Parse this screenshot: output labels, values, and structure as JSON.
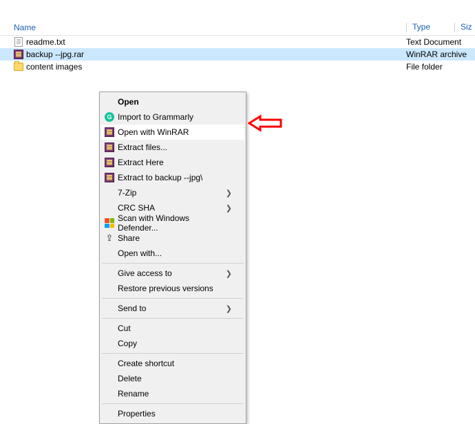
{
  "columns": {
    "name": "Name",
    "type": "Type",
    "size": "Siz"
  },
  "files": [
    {
      "name": "readme.txt",
      "type": "Text Document",
      "icon": "txt",
      "selected": false
    },
    {
      "name": "backup --jpg.rar",
      "type": "WinRAR archive",
      "icon": "rar",
      "selected": true
    },
    {
      "name": "content images",
      "type": "File folder",
      "icon": "folder",
      "selected": false
    }
  ],
  "context_menu": [
    {
      "kind": "item",
      "label": "Open",
      "bold": true,
      "icon": ""
    },
    {
      "kind": "item",
      "label": "Import to Grammarly",
      "icon": "grammarly"
    },
    {
      "kind": "item",
      "label": "Open with WinRAR",
      "icon": "rar",
      "highlighted": true
    },
    {
      "kind": "item",
      "label": "Extract files...",
      "icon": "rar"
    },
    {
      "kind": "item",
      "label": "Extract Here",
      "icon": "rar"
    },
    {
      "kind": "item",
      "label": "Extract to backup --jpg\\",
      "icon": "rar"
    },
    {
      "kind": "item",
      "label": "7-Zip",
      "submenu": true
    },
    {
      "kind": "item",
      "label": "CRC SHA",
      "submenu": true
    },
    {
      "kind": "item",
      "label": "Scan with Windows Defender...",
      "icon": "defender"
    },
    {
      "kind": "item",
      "label": "Share",
      "icon": "share"
    },
    {
      "kind": "item",
      "label": "Open with..."
    },
    {
      "kind": "sep"
    },
    {
      "kind": "item",
      "label": "Give access to",
      "submenu": true
    },
    {
      "kind": "item",
      "label": "Restore previous versions"
    },
    {
      "kind": "sep"
    },
    {
      "kind": "item",
      "label": "Send to",
      "submenu": true
    },
    {
      "kind": "sep"
    },
    {
      "kind": "item",
      "label": "Cut"
    },
    {
      "kind": "item",
      "label": "Copy"
    },
    {
      "kind": "sep"
    },
    {
      "kind": "item",
      "label": "Create shortcut"
    },
    {
      "kind": "item",
      "label": "Delete"
    },
    {
      "kind": "item",
      "label": "Rename"
    },
    {
      "kind": "sep"
    },
    {
      "kind": "item",
      "label": "Properties"
    }
  ],
  "arrow_chevron": "❯"
}
